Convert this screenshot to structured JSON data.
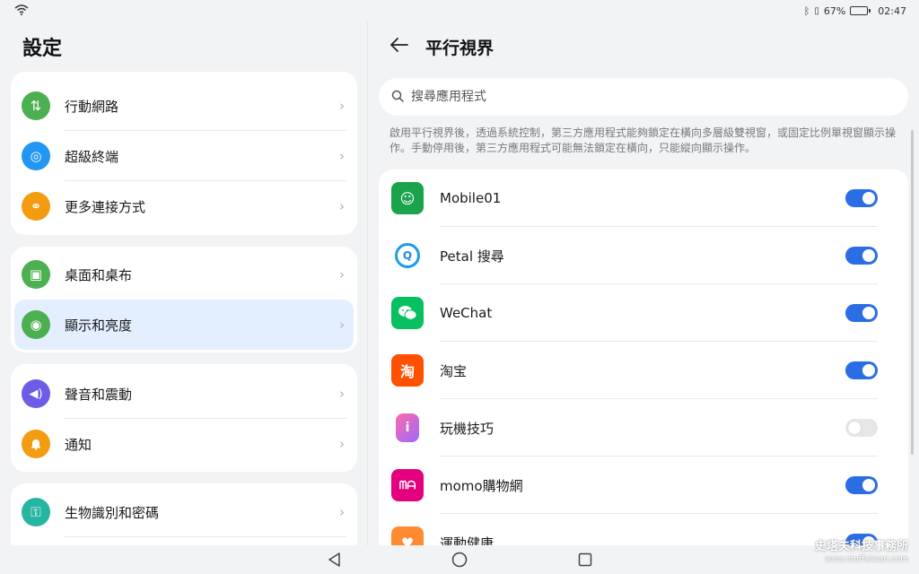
{
  "status_bar": {
    "battery_percent": "67%",
    "time": "02:47",
    "battery_level": 0.67
  },
  "left": {
    "title": "設定",
    "groups": [
      {
        "items": [
          {
            "label": "行動網路",
            "icon": "mobile-data-icon",
            "color": "#4caf50",
            "glyph": "⇅"
          },
          {
            "label": "超級終端",
            "icon": "super-device-icon",
            "color": "#2196f3",
            "glyph": "◎"
          },
          {
            "label": "更多連接方式",
            "icon": "link-icon",
            "color": "#f39c12",
            "glyph": "⚭"
          }
        ]
      },
      {
        "items": [
          {
            "label": "桌面和桌布",
            "icon": "wallpaper-icon",
            "color": "#4caf50",
            "glyph": "▣"
          },
          {
            "label": "顯示和亮度",
            "icon": "eye-icon",
            "color": "#4caf50",
            "glyph": "◉"
          }
        ]
      },
      {
        "items": [
          {
            "label": "聲音和震動",
            "icon": "speaker-icon",
            "color": "#6c5ce7",
            "glyph": "🔊"
          },
          {
            "label": "通知",
            "icon": "bell-icon",
            "color": "#f39c12",
            "glyph": "🔔"
          }
        ]
      },
      {
        "items": [
          {
            "label": "生物識別和密碼",
            "icon": "key-icon",
            "color": "#26b5a0",
            "glyph": "⚿"
          }
        ]
      }
    ],
    "selected": "顯示和亮度"
  },
  "right": {
    "title": "平行視界",
    "search_placeholder": "搜尋應用程式",
    "description": "啟用平行視界後，透過系統控制，第三方應用程式能夠鎖定在橫向多層級雙視窗，或固定比例單視窗顯示操作。手動停用後，第三方應用程式可能無法鎖定在橫向，只能縱向顯示操作。",
    "apps": [
      {
        "name": "Mobile01",
        "on": true,
        "color": "#1aa34a",
        "glyph": "☺"
      },
      {
        "name": "Petal 搜尋",
        "on": true,
        "color": "#ffffff",
        "glyph": "Q"
      },
      {
        "name": "WeChat",
        "on": true,
        "color": "#07c160",
        "glyph": "✉"
      },
      {
        "name": "淘宝",
        "on": true,
        "color": "#ff5000",
        "glyph": "淘"
      },
      {
        "name": "玩機技巧",
        "on": false,
        "color": "#ffffff",
        "glyph": "i"
      },
      {
        "name": "momo購物網",
        "on": true,
        "color": "#e4007f",
        "glyph": "m"
      },
      {
        "name": "運動健康",
        "on": true,
        "color": "#ff8a30",
        "glyph": "♥"
      }
    ]
  },
  "watermark": {
    "line1": "史塔夫科技事務所",
    "line2": "www.stuffaiwan.com"
  }
}
